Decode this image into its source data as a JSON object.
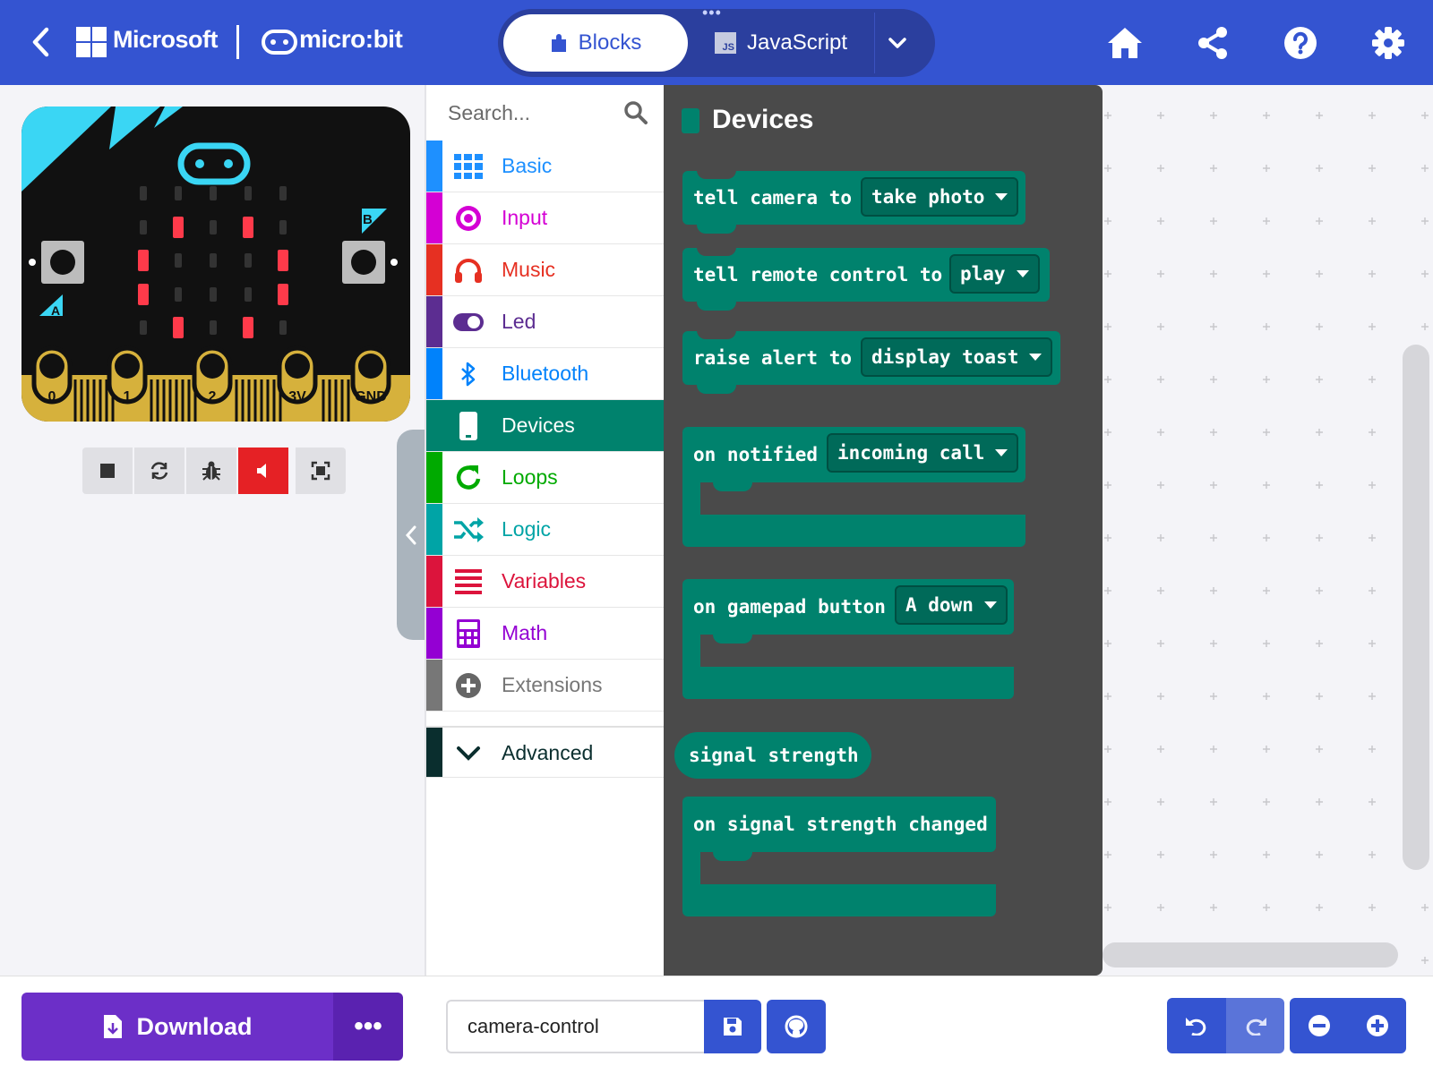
{
  "header": {
    "brand": "Microsoft",
    "product": "micro:bit",
    "tabs": [
      {
        "label": "Blocks",
        "active": true
      },
      {
        "label": "JavaScript",
        "active": false
      }
    ],
    "js_badge": "JS",
    "colors": {
      "bar": "#3454d1",
      "toggle_bg": "#2b3f9e"
    }
  },
  "simulator": {
    "board_labels": {
      "button_a": "A",
      "button_b": "B",
      "pins": [
        "0",
        "1",
        "2",
        "3V",
        "GND"
      ]
    },
    "led_matrix": [
      [
        0,
        0,
        0,
        0,
        0
      ],
      [
        0,
        1,
        0,
        1,
        0
      ],
      [
        1,
        0,
        0,
        0,
        1
      ],
      [
        1,
        0,
        0,
        0,
        1
      ],
      [
        0,
        1,
        0,
        1,
        0
      ]
    ],
    "controls": [
      {
        "icon": "stop-icon"
      },
      {
        "icon": "restart-icon"
      },
      {
        "icon": "debug-icon"
      },
      {
        "icon": "mute-icon",
        "active": true
      },
      {
        "icon": "fullscreen-icon"
      }
    ]
  },
  "toolbox": {
    "search_placeholder": "Search...",
    "categories": [
      {
        "label": "Basic",
        "color": "#1e90ff",
        "icon": "grid-icon"
      },
      {
        "label": "Input",
        "color": "#d400d4",
        "icon": "target-icon"
      },
      {
        "label": "Music",
        "color": "#e63022",
        "icon": "headphones-icon"
      },
      {
        "label": "Led",
        "color": "#5c2d91",
        "icon": "toggle-icon"
      },
      {
        "label": "Bluetooth",
        "color": "#0082fb",
        "icon": "bluetooth-icon"
      },
      {
        "label": "Devices",
        "color": "#00826d",
        "icon": "phone-icon",
        "selected": true
      },
      {
        "label": "Loops",
        "color": "#00aa00",
        "icon": "loop-icon"
      },
      {
        "label": "Logic",
        "color": "#00a4a6",
        "icon": "shuffle-icon"
      },
      {
        "label": "Variables",
        "color": "#dc143c",
        "icon": "lines-icon"
      },
      {
        "label": "Math",
        "color": "#9400d3",
        "icon": "calculator-icon"
      },
      {
        "label": "Extensions",
        "color": "#777777",
        "icon": "plus-circle-icon"
      },
      {
        "label": "Advanced",
        "color": "#0a2e2e",
        "icon": "chevron-down-icon"
      }
    ]
  },
  "flyout": {
    "title": "Devices",
    "block_color": "#00826d",
    "blocks": [
      {
        "text": "tell camera to",
        "dropdown": "take photo"
      },
      {
        "text": "tell remote control to",
        "dropdown": "play"
      },
      {
        "text": "raise alert to",
        "dropdown": "display toast"
      },
      {
        "text": "on notified",
        "dropdown": "incoming call"
      },
      {
        "text": "on gamepad button",
        "dropdown": "A down"
      },
      {
        "text": "signal strength"
      },
      {
        "text": "on signal strength changed"
      }
    ]
  },
  "footer": {
    "download_label": "Download",
    "more_label": "•••",
    "project_name": "camera-control",
    "download_color": "#6c2fc8"
  }
}
